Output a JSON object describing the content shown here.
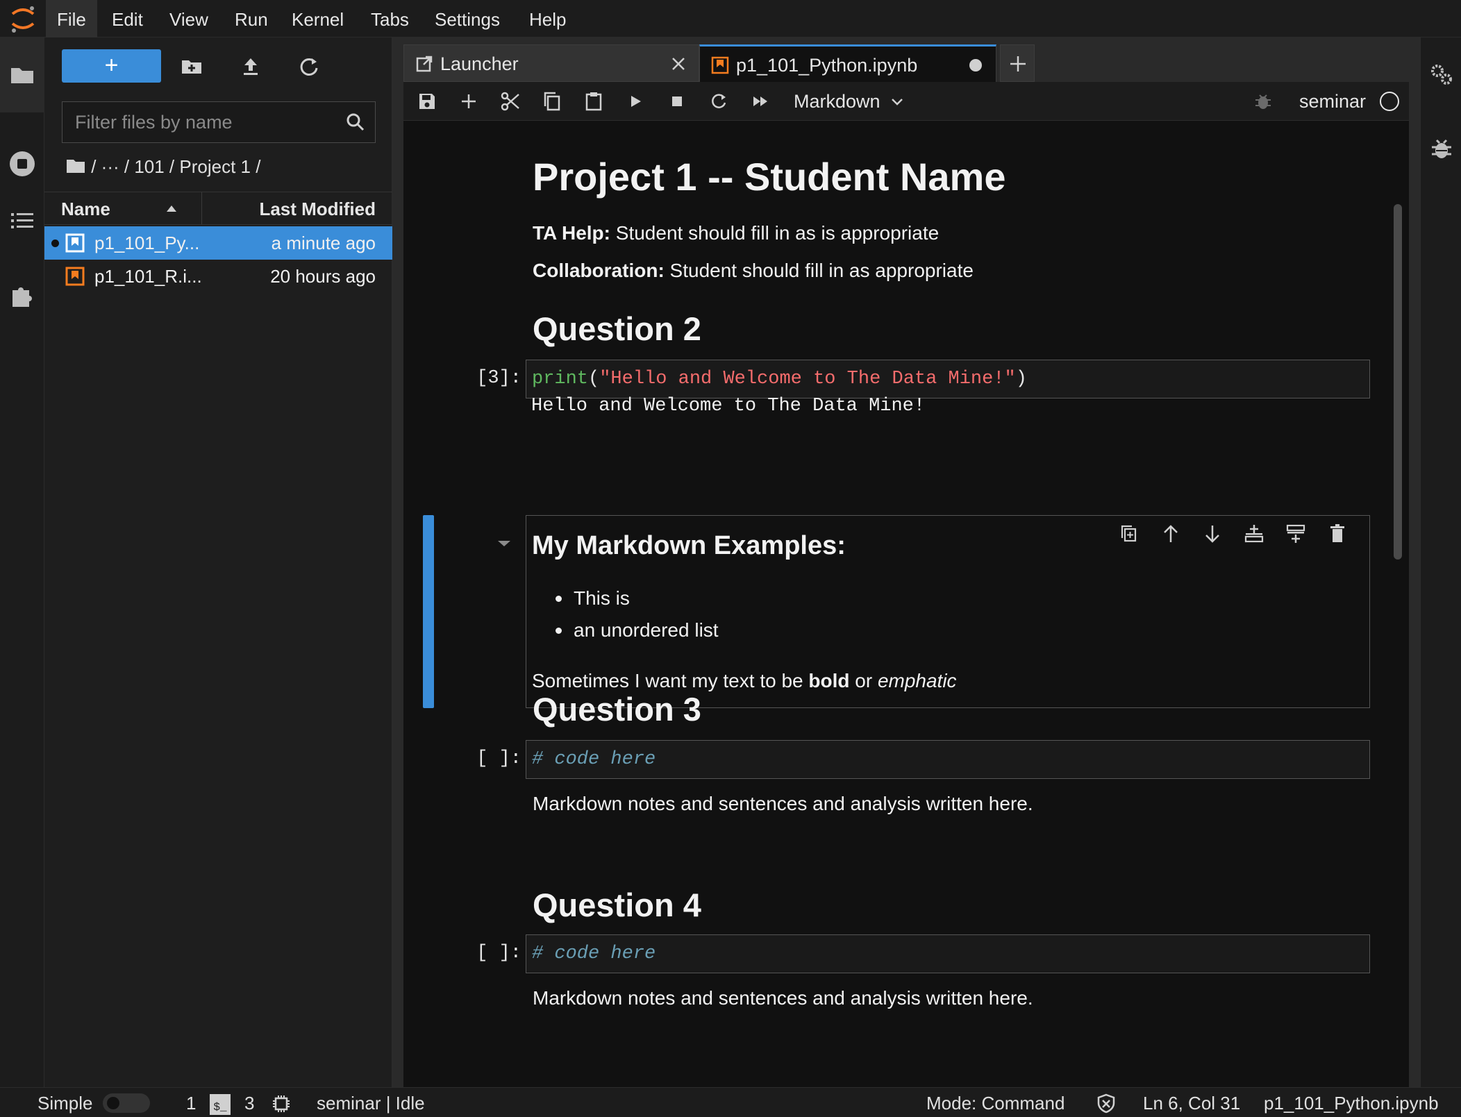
{
  "menubar": {
    "items": [
      "File",
      "Edit",
      "View",
      "Run",
      "Kernel",
      "Tabs",
      "Settings",
      "Help"
    ]
  },
  "filebrowser": {
    "new_label": "+",
    "filter_placeholder": "Filter files by name",
    "breadcrumb": "/ ··· / 101 / Project 1 /",
    "col_name": "Name",
    "col_modified": "Last Modified",
    "files": [
      {
        "name": "p1_101_Py...",
        "modified": "a minute ago",
        "selected": true,
        "running": true
      },
      {
        "name": "p1_101_R.i...",
        "modified": "20 hours ago",
        "selected": false,
        "running": false
      }
    ]
  },
  "tabs": [
    {
      "label": "Launcher",
      "icon": "launcher-icon"
    },
    {
      "label": "p1_101_Python.ipynb",
      "icon": "notebook-icon",
      "active": true,
      "dirty": true
    }
  ],
  "notebook_toolbar": {
    "cell_type": "Markdown",
    "kernel": "seminar"
  },
  "notebook": {
    "title": "Project 1 -- Student Name",
    "ta_help_label": "TA Help:",
    "ta_help_text": " Student should fill in as is appropriate",
    "collab_label": "Collaboration:",
    "collab_text": " Student should fill in as appropriate",
    "q2": "Question 2",
    "cell3_prompt": "[3]:",
    "cell3_code_fn": "print",
    "cell3_code_open": "(",
    "cell3_code_str": "\"Hello and Welcome to The Data Mine!\"",
    "cell3_code_close": ")",
    "cell3_output": "Hello and Welcome to The Data Mine!",
    "md_heading": "My Markdown Examples:",
    "md_list": [
      "This is",
      "an unordered list"
    ],
    "md_sentence_pre": "Sometimes I want my text to be ",
    "md_sentence_bold": "bold",
    "md_sentence_mid": " or ",
    "md_sentence_em": "emphatic",
    "q3": "Question 3",
    "empty_prompt": "[ ]:",
    "code_comment": "# code here",
    "md_notes": "Markdown notes and sentences and analysis written here.",
    "q4": "Question 4"
  },
  "statusbar": {
    "mode_simple": "Simple",
    "terminals": "1",
    "kernels": "3",
    "kernel_status": "seminar | Idle",
    "mode": "Mode: Command",
    "cursor": "Ln 6, Col 31",
    "filename": "p1_101_Python.ipynb"
  },
  "colors": {
    "accent": "#3a8dd9",
    "notebook_orange": "#f57c1f",
    "code_keyword": "#5fb85f",
    "code_string": "#f46c6c",
    "code_comment": "#6a9fb5"
  }
}
